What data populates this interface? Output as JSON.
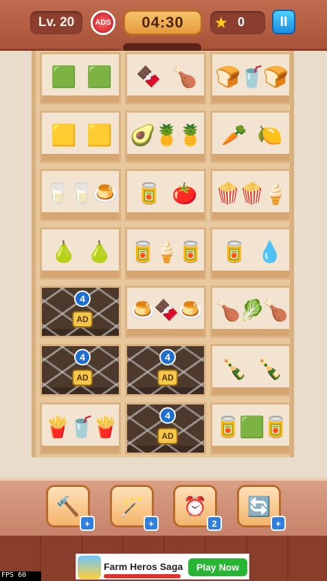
{
  "header": {
    "level": "Lv. 20",
    "ads_label": "ADS",
    "timer": "04:30",
    "stars": "0",
    "pause_label": "II"
  },
  "shelf": {
    "rows": [
      [
        {
          "locked": false,
          "items": [
            "🟩",
            "🟩"
          ]
        },
        {
          "locked": false,
          "items": [
            "🍫",
            "🍗"
          ]
        },
        {
          "locked": false,
          "items": [
            "🍞",
            "🥤",
            "🍞"
          ]
        }
      ],
      [
        {
          "locked": false,
          "items": [
            "🟨",
            "🟨"
          ]
        },
        {
          "locked": false,
          "items": [
            "🥑",
            "🍍",
            "🍍"
          ]
        },
        {
          "locked": false,
          "items": [
            "🥕",
            "🍋"
          ]
        }
      ],
      [
        {
          "locked": false,
          "items": [
            "🥛",
            "🥛",
            "🍮"
          ]
        },
        {
          "locked": false,
          "items": [
            "🥫",
            "🍅"
          ]
        },
        {
          "locked": false,
          "items": [
            "🍿",
            "🍿",
            "🍦"
          ]
        }
      ],
      [
        {
          "locked": false,
          "items": [
            "🍐",
            "🍐"
          ]
        },
        {
          "locked": false,
          "items": [
            "🥫",
            "🍦",
            "🥫"
          ]
        },
        {
          "locked": false,
          "items": [
            "🥫",
            "💧"
          ]
        }
      ],
      [
        {
          "locked": true,
          "count": "4",
          "ad": "AD"
        },
        {
          "locked": false,
          "items": [
            "🍮",
            "🍫",
            "🍮"
          ]
        },
        {
          "locked": false,
          "items": [
            "🍗",
            "🥬",
            "🍗"
          ]
        }
      ],
      [
        {
          "locked": true,
          "count": "4",
          "ad": "AD"
        },
        {
          "locked": true,
          "count": "4",
          "ad": "AD"
        },
        {
          "locked": false,
          "items": [
            "🍾",
            "🍾"
          ]
        }
      ],
      [
        {
          "locked": false,
          "items": [
            "🍟",
            "🥤",
            "🍟"
          ]
        },
        {
          "locked": true,
          "count": "4",
          "ad": "AD"
        },
        {
          "locked": false,
          "items": [
            "🥫",
            "🟩",
            "🥫"
          ]
        }
      ]
    ]
  },
  "boosters": [
    {
      "name": "hammer-booster",
      "icon": "🔨",
      "badge": "+"
    },
    {
      "name": "magic-wand-booster",
      "icon": "🪄",
      "badge": "+"
    },
    {
      "name": "alarm-clock-booster",
      "icon": "⏰",
      "badge": "2"
    },
    {
      "name": "shuffle-booster",
      "icon": "🔄",
      "badge": "+"
    }
  ],
  "ad": {
    "title": "Farm Heros Saga",
    "cta": "Play Now"
  },
  "fps": "FPS 60"
}
